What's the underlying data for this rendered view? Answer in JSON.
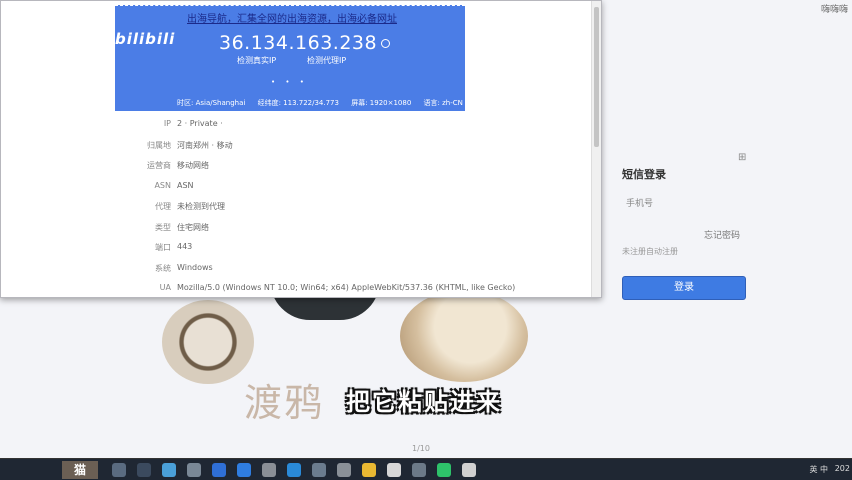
{
  "background": {
    "top_right_text": "嗨嗨嗨",
    "logo_text": "渡鸦",
    "subtitle_text": "把它粘贴进来",
    "pager": "1/10"
  },
  "login_panel": {
    "title": "短信登录",
    "user_text": "手机号",
    "link_text": "忘记密码",
    "note_text": "未注册自动注册",
    "button_label": "登录"
  },
  "window": {
    "hero": {
      "link_text": "出海导航，汇集全网的出海资源，出海必备网址",
      "brand_text": "bilibili",
      "ip": "36.134.163.238",
      "button1": "检测真实IP",
      "button2": "检测代理IP",
      "info": [
        "时区: Asia/Shanghai",
        "经纬度: 113.722/34.773",
        "屏幕: 1920×1080",
        "语言: zh-CN"
      ]
    },
    "rows": [
      {
        "key": "IP",
        "value": "2 · Private ·"
      },
      {
        "key": "归属地",
        "value": "河南郑州 · 移动"
      },
      {
        "key": "运营商",
        "value": "移动网络"
      },
      {
        "key": "ASN",
        "value": "ASN"
      },
      {
        "key": "代理",
        "value": "未检测到代理"
      },
      {
        "key": "类型",
        "value": "住宅网络"
      },
      {
        "key": "端口",
        "value": "443"
      },
      {
        "key": "系统",
        "value": "Windows"
      },
      {
        "key": "UA",
        "value": "Mozilla/5.0 (Windows NT 10.0; Win64; x64) AppleWebKit/537.36 (KHTML, like Gecko)"
      }
    ]
  },
  "taskbar": {
    "start_label": "猫",
    "tray_text": "英 中",
    "clock": "202",
    "icons": [
      {
        "name": "file-explorer-icon",
        "color": "#5a6b80"
      },
      {
        "name": "chart-icon",
        "color": "#3b4a5e"
      },
      {
        "name": "photos-icon",
        "color": "#4aa0d8"
      },
      {
        "name": "media-icon",
        "color": "#7a8896"
      },
      {
        "name": "mail-icon",
        "color": "#2f6fd6"
      },
      {
        "name": "browser-icon",
        "color": "#2f7de0"
      },
      {
        "name": "settings-icon",
        "color": "#8a8f96"
      },
      {
        "name": "edge-icon",
        "color": "#2a8ad8"
      },
      {
        "name": "app-icon",
        "color": "#6b7c8e"
      },
      {
        "name": "eye-icon",
        "color": "#8a9097"
      },
      {
        "name": "chrome-icon",
        "color": "#e9b832"
      },
      {
        "name": "note-icon",
        "color": "#d7d7d7"
      },
      {
        "name": "game-icon",
        "color": "#6c7a88"
      },
      {
        "name": "wechat-icon",
        "color": "#2ec26a"
      },
      {
        "name": "camera-icon",
        "color": "#d0d0d0"
      }
    ]
  }
}
